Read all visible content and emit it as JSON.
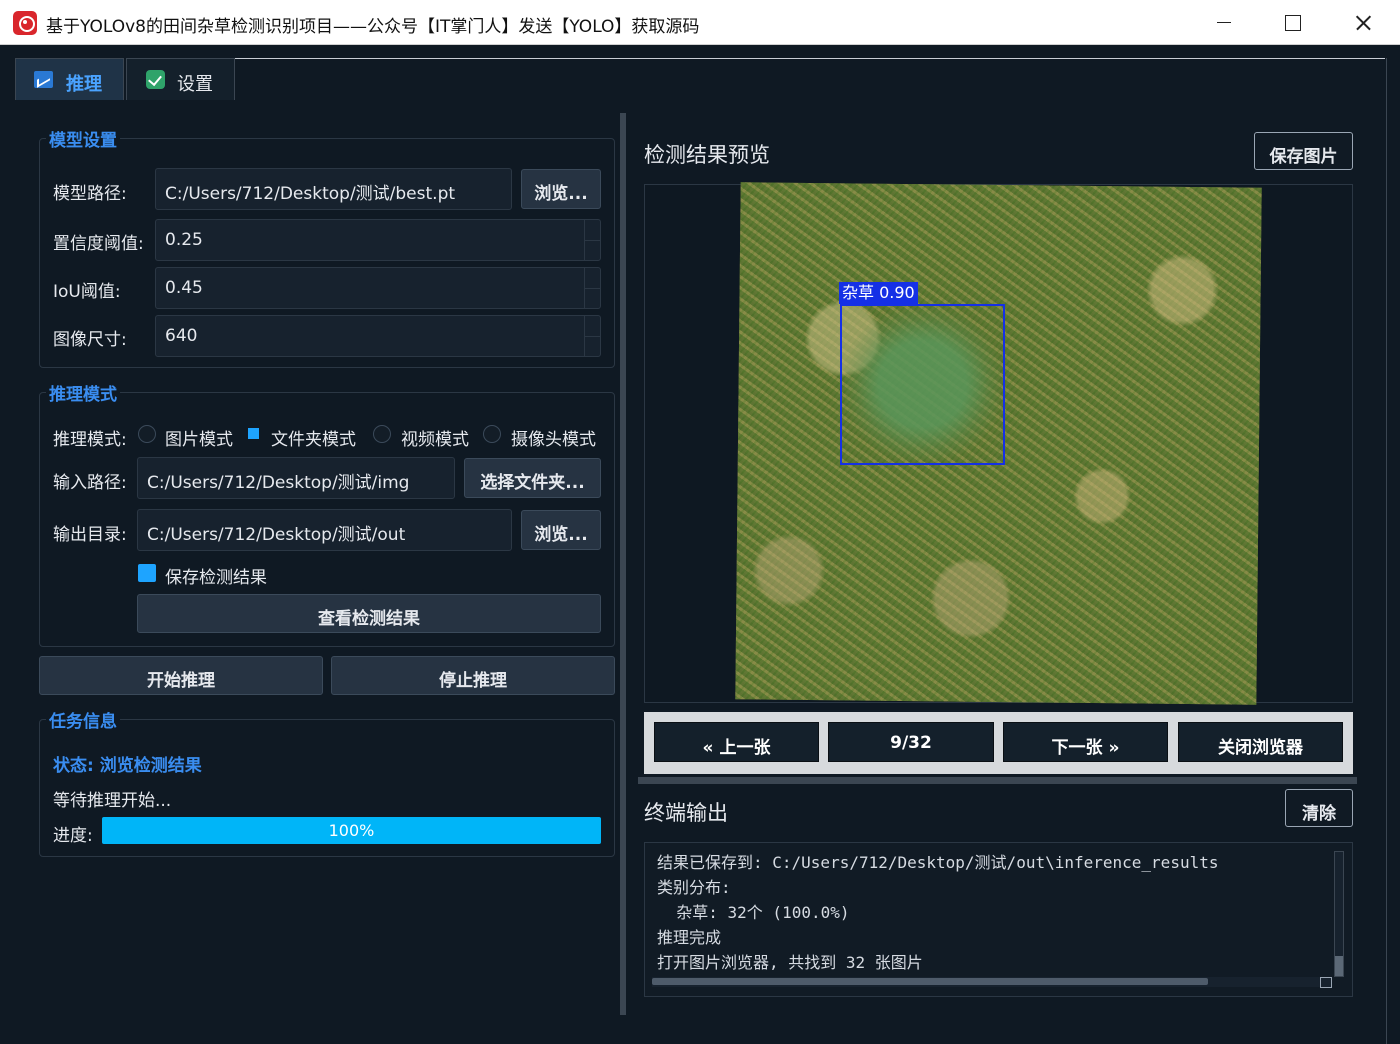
{
  "window": {
    "title": "基于YOLOv8的田间杂草检测识别项目——公众号【IT掌门人】发送【YOLO】获取源码"
  },
  "tabs": [
    {
      "label": "推理",
      "icon": "chart-icon",
      "active": true
    },
    {
      "label": "设置",
      "icon": "check-icon",
      "active": false
    }
  ],
  "model_settings": {
    "title": "模型设置",
    "model_path_label": "模型路径:",
    "model_path_value": "C:/Users/712/Desktop/测试/best.pt",
    "browse_label": "浏览...",
    "confidence_label": "置信度阈值:",
    "confidence_value": "0.25",
    "iou_label": "IoU阈值:",
    "iou_value": "0.45",
    "image_size_label": "图像尺寸:",
    "image_size_value": "640"
  },
  "inference_mode": {
    "title": "推理模式",
    "mode_label": "推理模式:",
    "modes": [
      "图片模式",
      "文件夹模式",
      "视频模式",
      "摄像头模式"
    ],
    "selected_mode": "文件夹模式",
    "input_label": "输入路径:",
    "input_value": "C:/Users/712/Desktop/测试/img",
    "select_folder_label": "选择文件夹...",
    "output_label": "输出目录:",
    "output_value": "C:/Users/712/Desktop/测试/out",
    "output_browse_label": "浏览...",
    "save_results_label": "保存检测结果",
    "save_results_checked": true,
    "view_results_label": "查看检测结果"
  },
  "actions": {
    "start_label": "开始推理",
    "stop_label": "停止推理"
  },
  "task_info": {
    "title": "任务信息",
    "status_text": "状态: 浏览检测结果",
    "message": "等待推理开始...",
    "progress_label": "进度:",
    "progress_value": 100,
    "progress_text": "100%"
  },
  "preview": {
    "title": "检测结果预览",
    "save_image_label": "保存图片",
    "detection_label": "杂草 0.90",
    "detection_class": "杂草",
    "detection_confidence": 0.9
  },
  "navigator": {
    "prev_label": "« 上一张",
    "counter": "9/32",
    "next_label": "下一张 »",
    "close_label": "关闭浏览器"
  },
  "terminal": {
    "title": "终端输出",
    "clear_label": "清除",
    "lines": [
      "结果已保存到: C:/Users/712/Desktop/测试/out\\inference_results",
      "类别分布:",
      "  杂草: 32个 (100.0%)",
      "推理完成",
      "打开图片浏览器, 共找到 32 张图片"
    ]
  },
  "colors": {
    "background": "#0f1923",
    "accent": "#3a8df0",
    "progress": "#00b5f8",
    "detection_box": "#1530e6"
  }
}
